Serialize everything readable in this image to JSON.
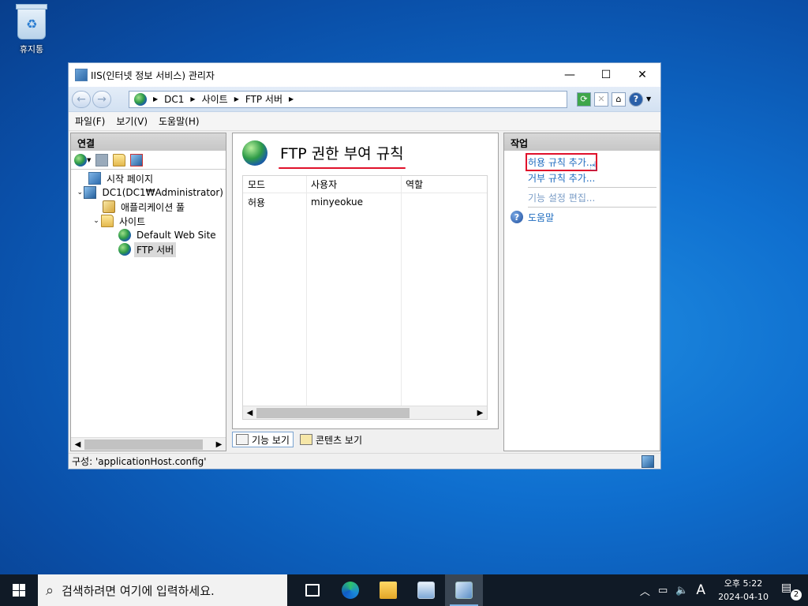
{
  "desktop": {
    "recycle_bin_label": "휴지통"
  },
  "window": {
    "title": "IIS(인터넷 정보 서비스) 관리자",
    "controls": {
      "minimize": "—",
      "maximize": "☐",
      "close": "✕"
    }
  },
  "address_bar": {
    "breadcrumb": [
      "DC1",
      "사이트",
      "FTP 서버"
    ]
  },
  "menu": [
    "파일(F)",
    "보기(V)",
    "도움말(H)"
  ],
  "connections": {
    "header": "연결",
    "tree": [
      {
        "label": "시작 페이지",
        "level": 1,
        "icon": "start-page-icon",
        "expander": ""
      },
      {
        "label": "DC1(DC1₩Administrator)",
        "level": 0,
        "icon": "server-icon",
        "expander": "⌄"
      },
      {
        "label": "애플리케이션 풀",
        "level": 2,
        "icon": "app-pool-icon",
        "expander": ""
      },
      {
        "label": "사이트",
        "level": 1,
        "icon": "folder-icon",
        "expander": "⌄"
      },
      {
        "label": "Default Web Site",
        "level": 3,
        "icon": "globe-icon",
        "expander": ""
      },
      {
        "label": "FTP 서버",
        "level": 3,
        "icon": "globe-icon",
        "expander": "",
        "selected": true
      }
    ]
  },
  "feature": {
    "title": "FTP 권한 부여 규칙",
    "columns": [
      "모드",
      "사용자",
      "역할"
    ],
    "rows": [
      {
        "mode": "허용",
        "user": "minyeokue",
        "role": ""
      }
    ]
  },
  "view_tabs": {
    "features": "기능 보기",
    "content": "콘텐츠 보기"
  },
  "actions": {
    "header": "작업",
    "add_allow": "허용 규칙 추가...",
    "add_deny": "거부 규칙 추가...",
    "edit_settings": "기능 설정 편집...",
    "help": "도움말"
  },
  "status": {
    "text": "구성: 'applicationHost.config'"
  },
  "taskbar": {
    "search_placeholder": "검색하려면 여기에 입력하세요.",
    "ime": "A",
    "clock_time": "오후 5:22",
    "clock_date": "2024-04-10",
    "notification_count": "2"
  },
  "colors": {
    "accent_red": "#e0112b",
    "link_blue": "#1e6bbf",
    "taskbar": "#101a26"
  }
}
